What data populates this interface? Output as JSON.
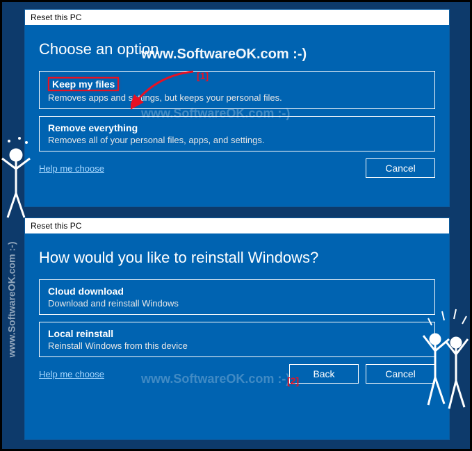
{
  "dialog1": {
    "title": "Reset this PC",
    "heading": "Choose an option",
    "option1": {
      "title": "Keep my files",
      "desc": "Removes apps and settings, but keeps your personal files."
    },
    "option2": {
      "title": "Remove everything",
      "desc": "Removes all of your personal files, apps, and settings."
    },
    "help": "Help me choose",
    "cancel": "Cancel"
  },
  "dialog2": {
    "title": "Reset this PC",
    "heading": "How would you like to reinstall Windows?",
    "option1": {
      "title": "Cloud download",
      "desc": "Download and reinstall Windows"
    },
    "option2": {
      "title": "Local reinstall",
      "desc": "Reinstall Windows from this device"
    },
    "help": "Help me choose",
    "back": "Back",
    "cancel": "Cancel"
  },
  "watermark": "www.SoftwareOK.com :-)",
  "annotations": {
    "one": "[1]",
    "two": "[2]"
  }
}
